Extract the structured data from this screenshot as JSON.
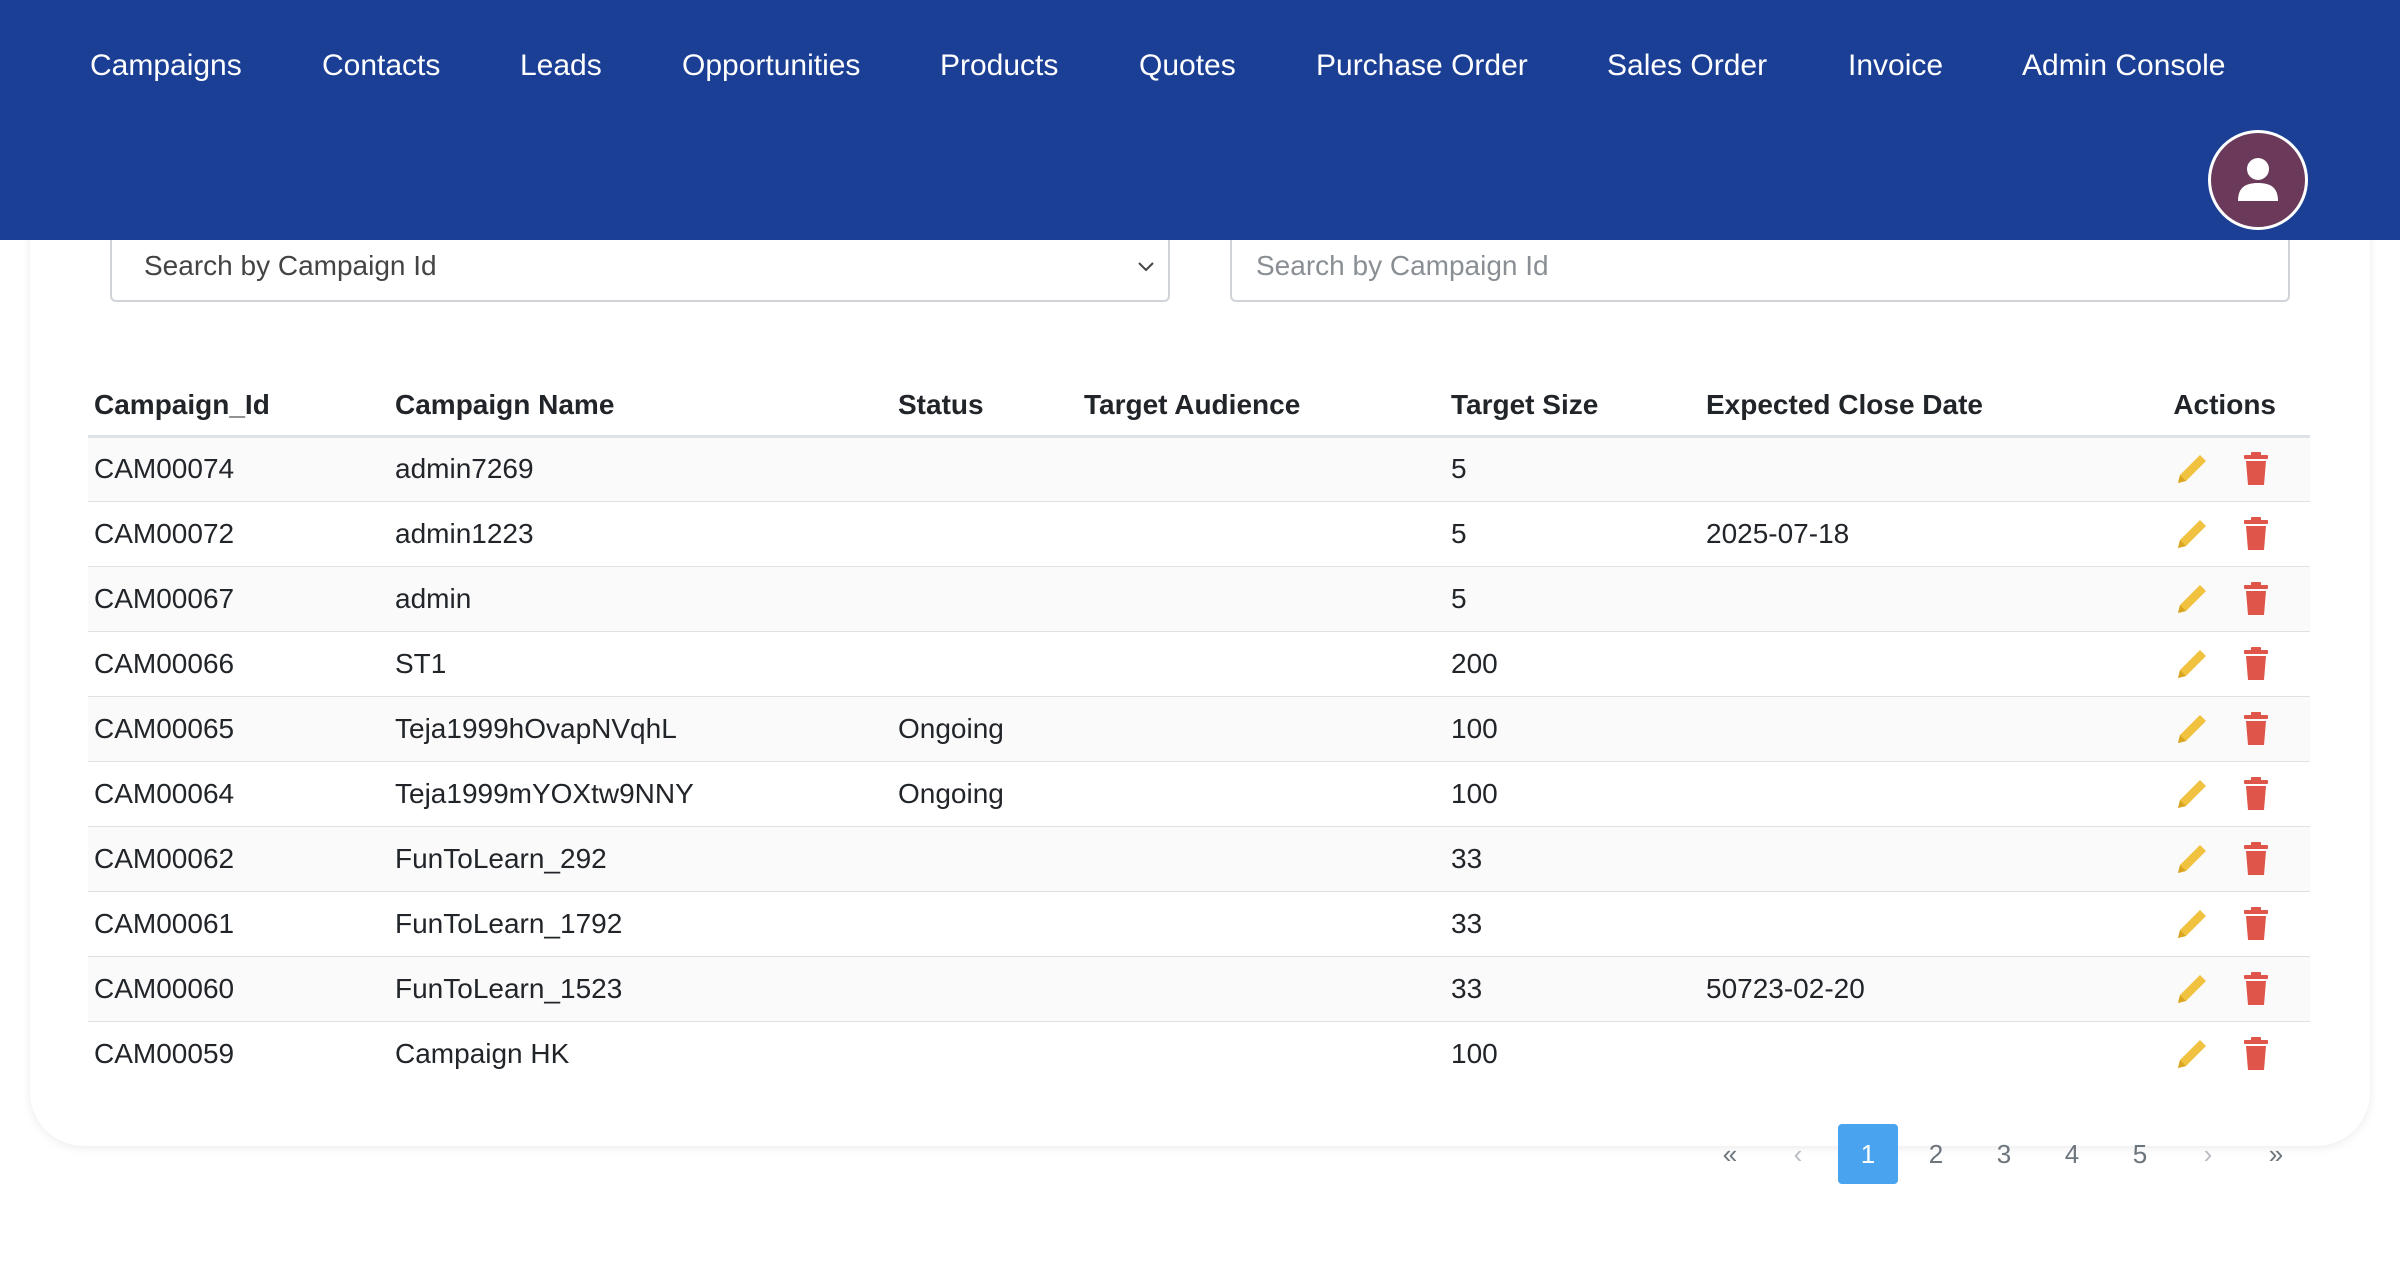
{
  "nav": {
    "items": [
      "Campaigns",
      "Contacts",
      "Leads",
      "Opportunities",
      "Products",
      "Quotes",
      "Purchase Order",
      "Sales Order",
      "Invoice",
      "Admin Console"
    ]
  },
  "search": {
    "select_value": "Search by Campaign Id",
    "input_placeholder": "Search by Campaign Id"
  },
  "table": {
    "headers": [
      "Campaign_Id",
      "Campaign Name",
      "Status",
      "Target Audience",
      "Target Size",
      "Expected Close Date",
      "Actions"
    ],
    "rows": [
      [
        "CAM00074",
        "admin7269",
        "",
        "",
        "5",
        ""
      ],
      [
        "CAM00072",
        "admin1223",
        "",
        "",
        "5",
        "2025-07-18"
      ],
      [
        "CAM00067",
        "admin",
        "",
        "",
        "5",
        ""
      ],
      [
        "CAM00066",
        "ST1",
        "",
        "",
        "200",
        ""
      ],
      [
        "CAM00065",
        "Teja1999hOvapNVqhL",
        "Ongoing",
        "",
        "100",
        ""
      ],
      [
        "CAM00064",
        "Teja1999mYOXtw9NNY",
        "Ongoing",
        "",
        "100",
        ""
      ],
      [
        "CAM00062",
        "FunToLearn_292",
        "",
        "",
        "33",
        ""
      ],
      [
        "CAM00061",
        "FunToLearn_1792",
        "",
        "",
        "33",
        ""
      ],
      [
        "CAM00060",
        "FunToLearn_1523",
        "",
        "",
        "33",
        "50723-02-20"
      ],
      [
        "CAM00059",
        "Campaign HK",
        "",
        "",
        "100",
        ""
      ]
    ]
  },
  "pagination": {
    "first": "«",
    "prev": "‹",
    "pages": [
      "1",
      "2",
      "3",
      "4",
      "5"
    ],
    "active": "1",
    "next": "›",
    "last": "»"
  },
  "icons": {
    "edit": "pencil-icon",
    "delete": "trash-icon",
    "user": "user-icon"
  },
  "colors": {
    "header_bg": "#1b3f95",
    "edit_icon": "#f0c240",
    "delete_icon": "#e0554a",
    "active_page": "#4aa3ee",
    "avatar_bg": "#6b3a5a"
  }
}
